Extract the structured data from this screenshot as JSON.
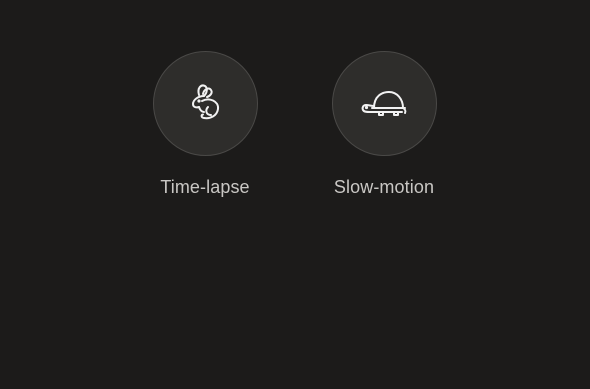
{
  "modes": [
    {
      "label": "Time-lapse",
      "icon": "rabbit-icon"
    },
    {
      "label": "Slow-motion",
      "icon": "turtle-icon"
    }
  ],
  "colors": {
    "background": "#1c1b1a",
    "circle": "#2e2d2b",
    "circle_border": "#4a4947",
    "label": "#c9c7c4",
    "icon_stroke": "#f2f2f2"
  }
}
